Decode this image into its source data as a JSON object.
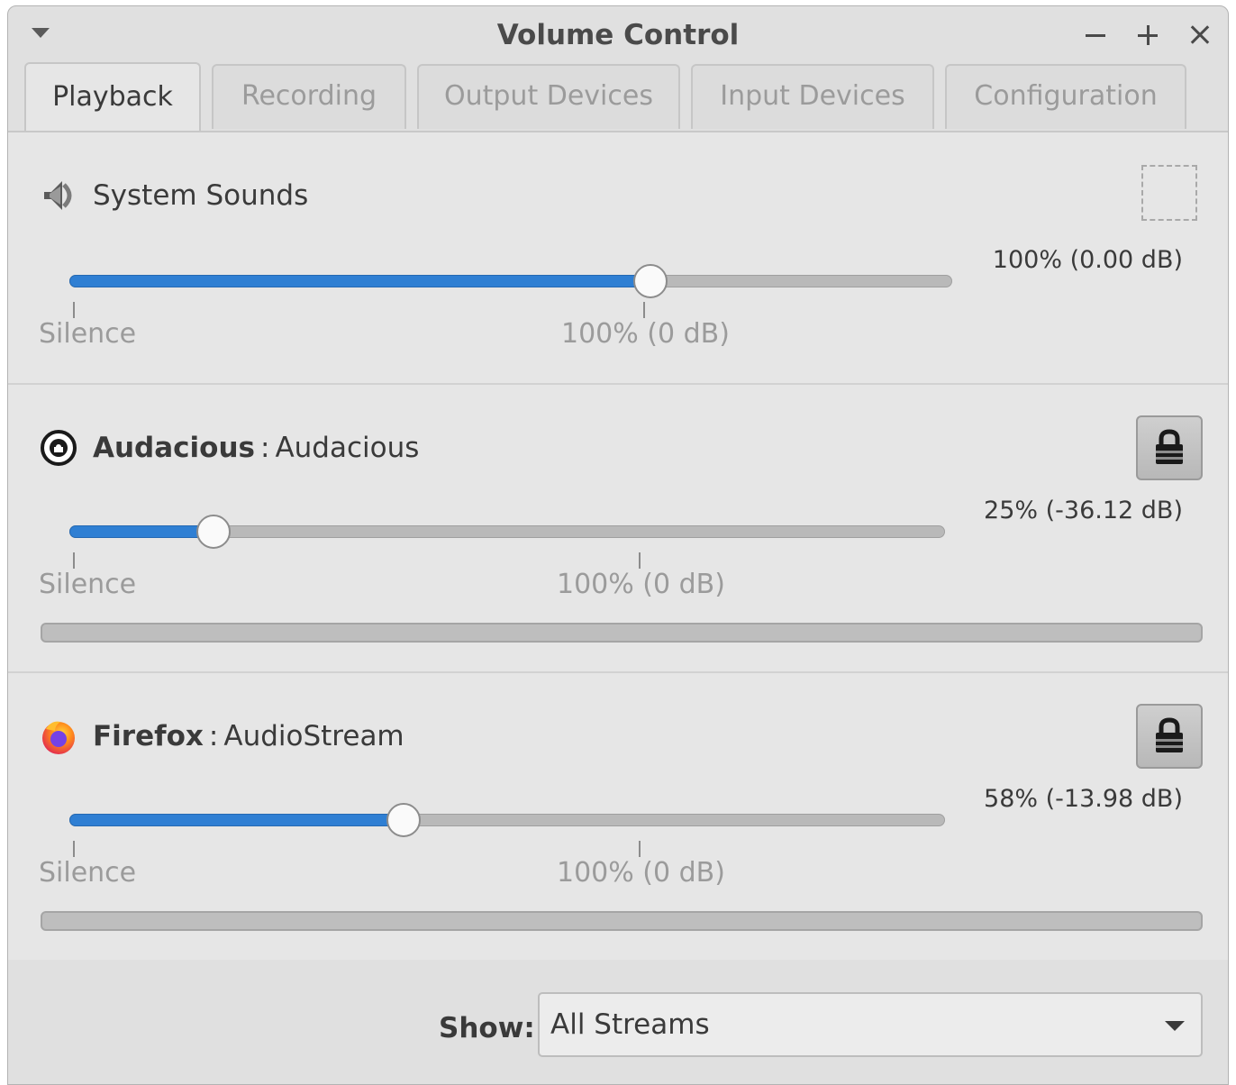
{
  "window": {
    "title": "Volume Control"
  },
  "tabs": [
    {
      "label": "Playback",
      "active": true
    },
    {
      "label": "Recording",
      "active": false
    },
    {
      "label": "Output Devices",
      "active": false
    },
    {
      "label": "Input Devices",
      "active": false
    },
    {
      "label": "Configuration",
      "active": false
    }
  ],
  "streams": [
    {
      "app_name": "System Sounds",
      "stream_name": "",
      "icon": "speaker-icon",
      "volume_readout": "100% (0.00 dB)",
      "volume_percent": 100,
      "scale_labels": {
        "silence": "Silence",
        "reference": "100% (0 dB)"
      },
      "control": "mute-placeholder"
    },
    {
      "app_name": "Audacious",
      "separator": ":",
      "stream_name": "Audacious",
      "icon": "audacious-icon",
      "volume_readout": "25% (-36.12 dB)",
      "volume_percent": 25,
      "scale_labels": {
        "silence": "Silence",
        "reference": "100% (0 dB)"
      },
      "control": "lock-icon",
      "level_fraction": 0
    },
    {
      "app_name": "Firefox",
      "separator": ":",
      "stream_name": "AudioStream",
      "icon": "firefox-icon",
      "volume_readout": "58% (-13.98 dB)",
      "volume_percent": 58,
      "scale_labels": {
        "silence": "Silence",
        "reference": "100% (0 dB)"
      },
      "control": "lock-icon",
      "level_fraction": 0
    }
  ],
  "footer": {
    "show_label": "Show:",
    "show_value": "All Streams"
  },
  "colors": {
    "accent": "#2f7fd3",
    "window_bg": "#e0e0e0"
  }
}
